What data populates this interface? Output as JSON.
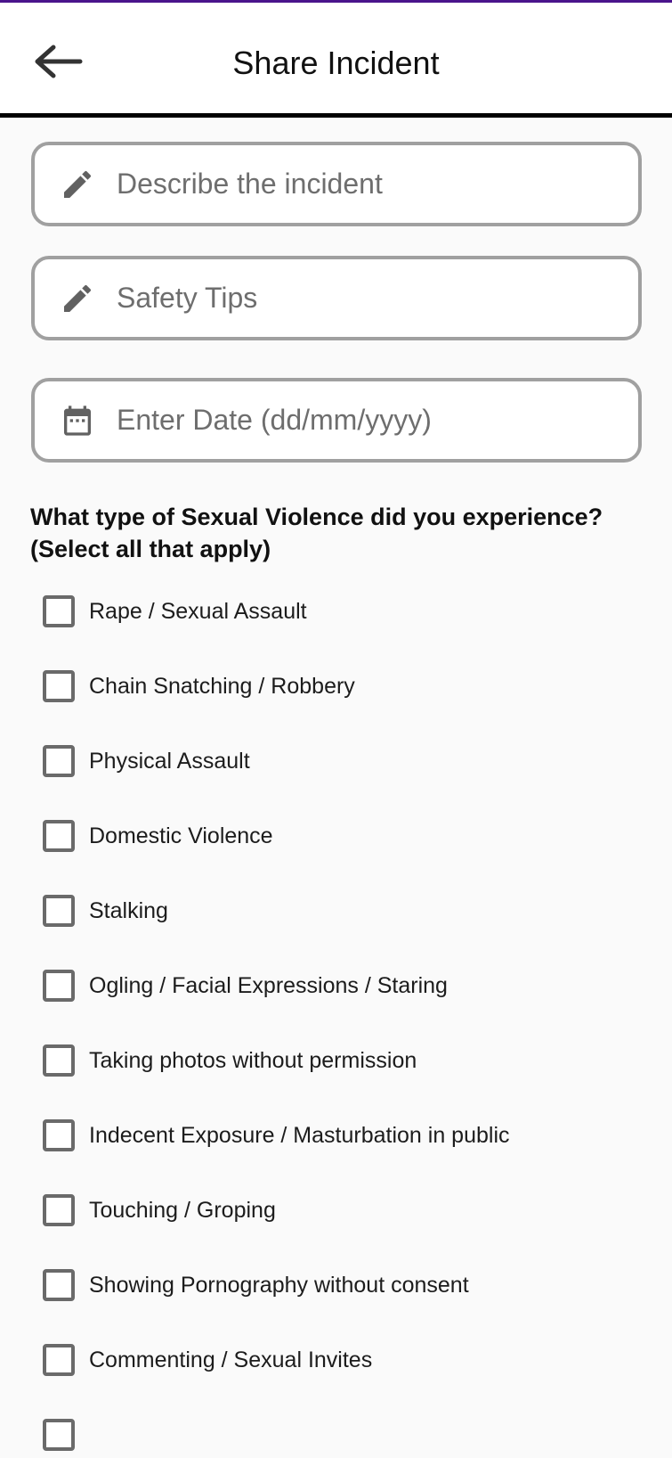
{
  "colors": {
    "accent": "#4a148c",
    "divider": "#000000",
    "field_border": "#a0a0a0",
    "icon": "#616161",
    "checkbox_border": "#6a6a6a"
  },
  "header": {
    "title": "Share Incident",
    "back_icon": "arrow-left-icon"
  },
  "form": {
    "description": {
      "placeholder": "Describe the incident",
      "value": "",
      "icon": "pencil-icon"
    },
    "safety_tips": {
      "placeholder": "Safety Tips",
      "value": "",
      "icon": "pencil-icon"
    },
    "date": {
      "placeholder": "Enter Date (dd/mm/yyyy)",
      "value": "",
      "icon": "calendar-icon"
    }
  },
  "question": {
    "line1": "What type of Sexual Violence did you experience?",
    "line2": "(Select all that apply)"
  },
  "options": [
    {
      "label": "Rape / Sexual Assault",
      "checked": false
    },
    {
      "label": "Chain Snatching / Robbery",
      "checked": false
    },
    {
      "label": "Physical Assault",
      "checked": false
    },
    {
      "label": "Domestic Violence",
      "checked": false
    },
    {
      "label": "Stalking",
      "checked": false
    },
    {
      "label": "Ogling / Facial Expressions / Staring",
      "checked": false
    },
    {
      "label": "Taking photos without permission",
      "checked": false
    },
    {
      "label": "Indecent Exposure / Masturbation in public",
      "checked": false
    },
    {
      "label": "Touching / Groping",
      "checked": false
    },
    {
      "label": "Showing Pornography without consent",
      "checked": false
    },
    {
      "label": "Commenting / Sexual Invites",
      "checked": false
    }
  ]
}
